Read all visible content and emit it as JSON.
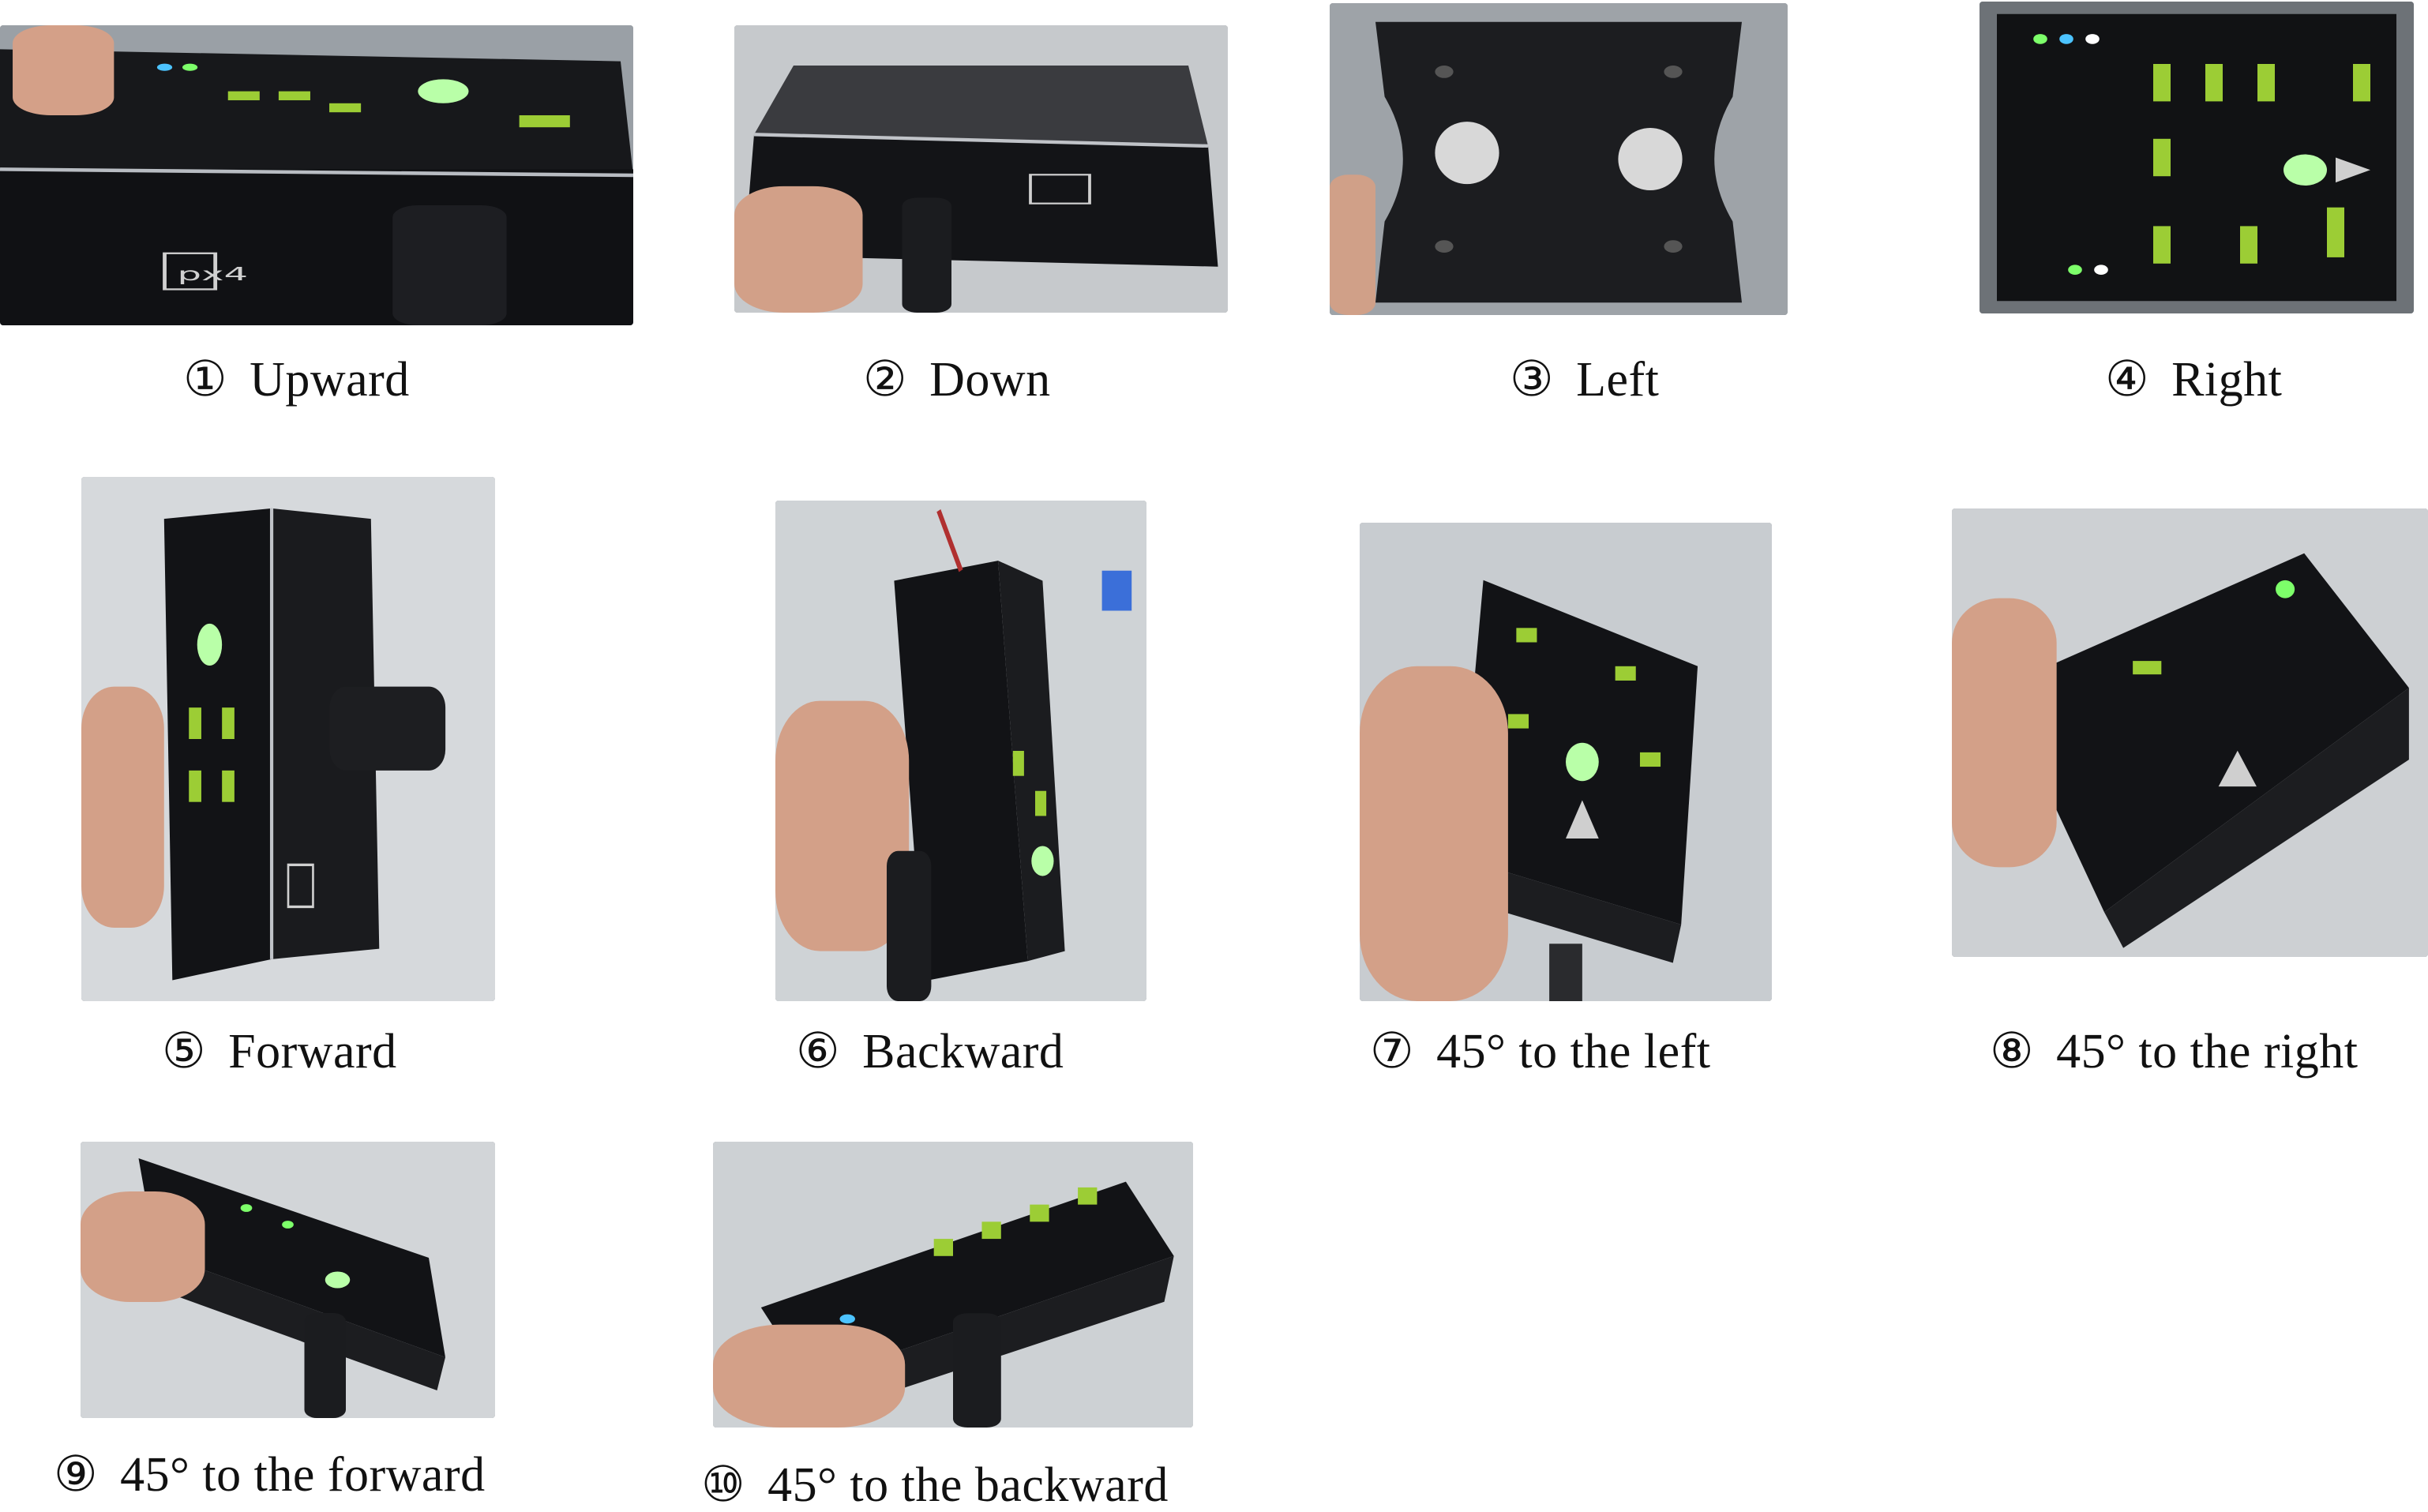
{
  "figure": {
    "panels": [
      {
        "num": "①",
        "label": "Upward"
      },
      {
        "num": "②",
        "label": "Down"
      },
      {
        "num": "③",
        "label": "Left"
      },
      {
        "num": "④",
        "label": "Right"
      },
      {
        "num": "⑤",
        "label": "Forward"
      },
      {
        "num": "⑥",
        "label": "Backward"
      },
      {
        "num": "⑦",
        "label": "45° to the left"
      },
      {
        "num": "⑧",
        "label": "45° to the right"
      },
      {
        "num": "⑨",
        "label": "45° to the forward"
      },
      {
        "num": "⑩",
        "label": "45° to the backward"
      }
    ],
    "colors": {
      "board": "#141518",
      "led_green": "#7dff6a",
      "hand": "#d9a48a",
      "background": "#c9ccce"
    }
  }
}
